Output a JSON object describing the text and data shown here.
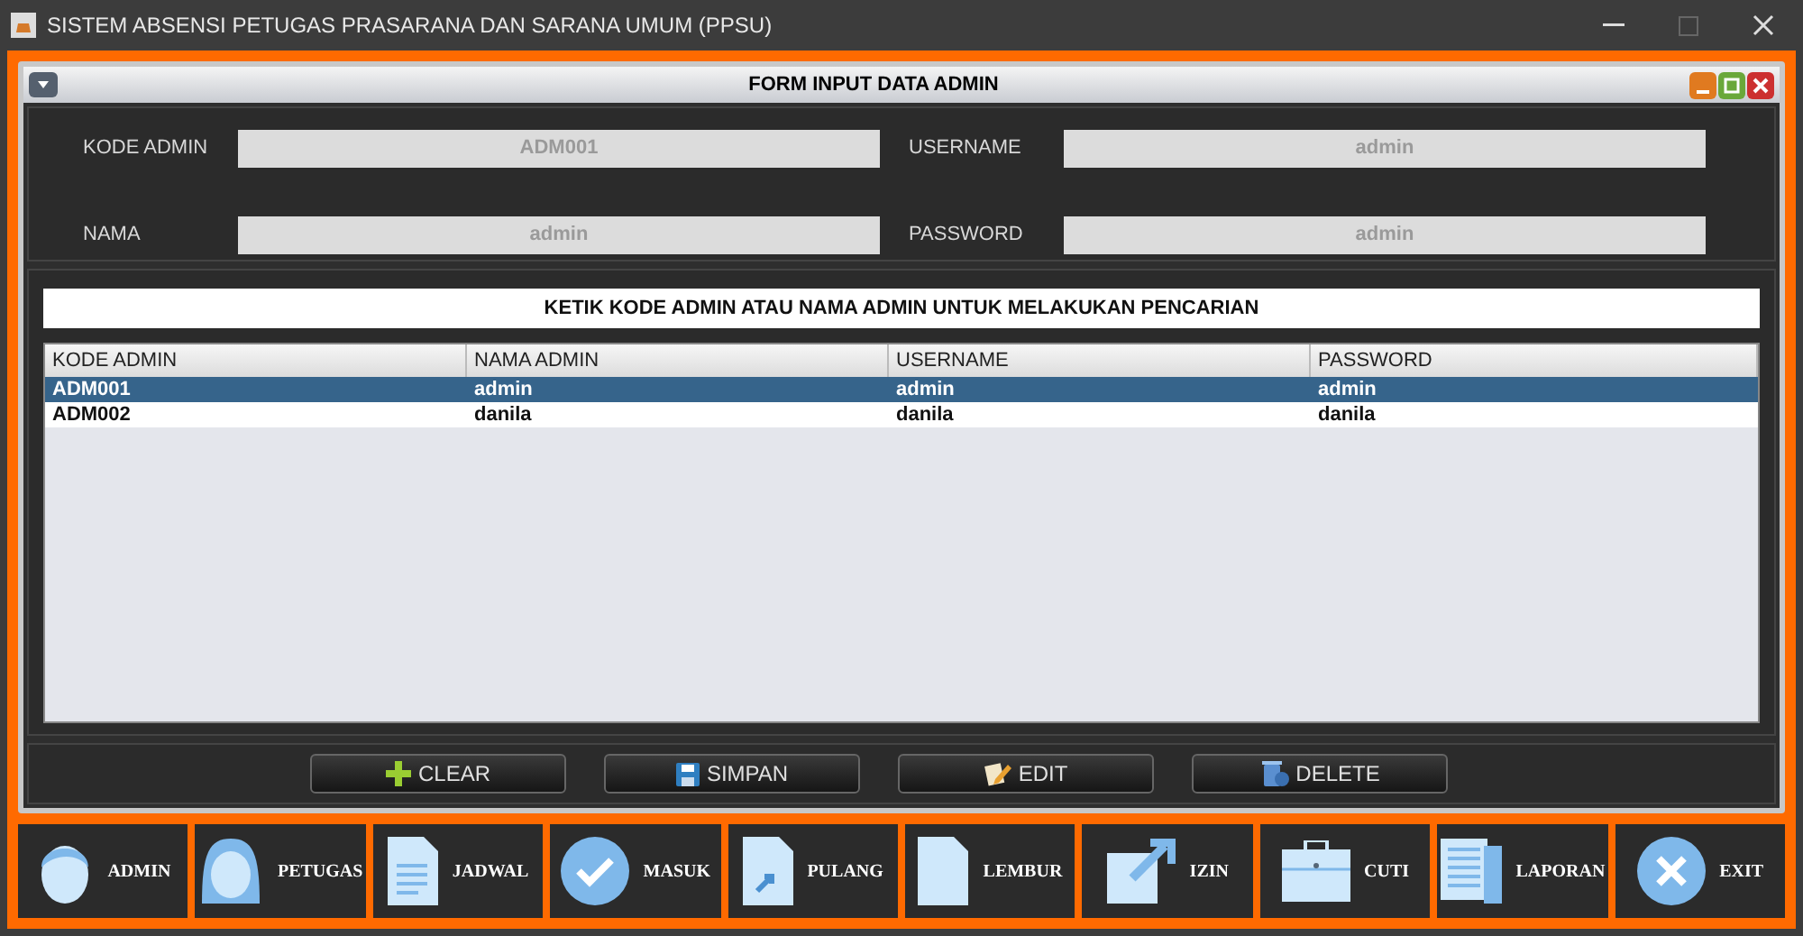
{
  "window": {
    "title": "SISTEM ABSENSI PETUGAS PRASARANA DAN SARANA UMUM (PPSU)"
  },
  "form": {
    "title": "FORM INPUT DATA ADMIN",
    "fields": [
      {
        "label": "KODE ADMIN",
        "value": "ADM001"
      },
      {
        "label": "USERNAME",
        "value": "admin"
      },
      {
        "label": "NAMA",
        "value": "admin"
      },
      {
        "label": "PASSWORD",
        "value": "admin"
      }
    ]
  },
  "search": {
    "placeholder": "KETIK KODE ADMIN ATAU NAMA ADMIN UNTUK MELAKUKAN PENCARIAN"
  },
  "table": {
    "columns": [
      "KODE ADMIN",
      "NAMA ADMIN",
      "USERNAME",
      "PASSWORD"
    ],
    "rows": [
      {
        "cells": [
          "ADM001",
          "admin",
          "admin",
          "admin"
        ],
        "selected": true
      },
      {
        "cells": [
          "ADM002",
          "danila",
          "danila",
          "danila"
        ],
        "selected": false
      }
    ]
  },
  "buttons": [
    {
      "label": "CLEAR",
      "kind": "plus"
    },
    {
      "label": "SIMPAN",
      "kind": "save"
    },
    {
      "label": "EDIT",
      "kind": "edit"
    },
    {
      "label": "DELETE",
      "kind": "delete"
    }
  ],
  "nav": [
    {
      "label": "ADMIN",
      "kind": "man"
    },
    {
      "label": "PETUGAS",
      "kind": "woman"
    },
    {
      "label": "JADWAL",
      "kind": "doc"
    },
    {
      "label": "MASUK",
      "kind": "check"
    },
    {
      "label": "PULANG",
      "kind": "share"
    },
    {
      "label": "LEMBUR",
      "kind": "blank"
    },
    {
      "label": "IZIN",
      "kind": "export"
    },
    {
      "label": "CUTI",
      "kind": "case"
    },
    {
      "label": "LAPORAN",
      "kind": "news"
    },
    {
      "label": "EXIT",
      "kind": "exit"
    }
  ]
}
